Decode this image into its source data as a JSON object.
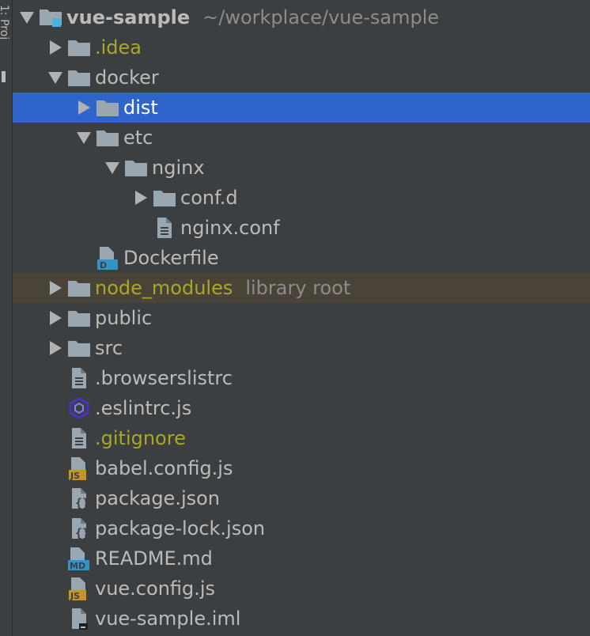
{
  "side_panel": {
    "label": "1: Proj"
  },
  "tree": [
    {
      "name": "vue-sample",
      "extra": "~/workplace/vue-sample",
      "level": 0,
      "expander": "expanded",
      "icon": "module-folder-icon",
      "style": "root"
    },
    {
      "name": ".idea",
      "level": 1,
      "expander": "collapsed",
      "icon": "folder-icon",
      "style": "ignored"
    },
    {
      "name": "docker",
      "level": 1,
      "expander": "expanded",
      "icon": "folder-icon",
      "style": "normal"
    },
    {
      "name": "dist",
      "level": 2,
      "expander": "collapsed",
      "icon": "folder-icon",
      "style": "selected"
    },
    {
      "name": "etc",
      "level": 2,
      "expander": "expanded",
      "icon": "folder-icon",
      "style": "normal"
    },
    {
      "name": "nginx",
      "level": 3,
      "expander": "expanded",
      "icon": "folder-icon",
      "style": "normal"
    },
    {
      "name": "conf.d",
      "level": 4,
      "expander": "collapsed",
      "icon": "folder-icon",
      "style": "normal"
    },
    {
      "name": "nginx.conf",
      "level": 4,
      "expander": "none",
      "icon": "text-file-icon",
      "style": "normal"
    },
    {
      "name": "Dockerfile",
      "level": 2,
      "expander": "none",
      "icon": "dockerfile-icon",
      "style": "normal"
    },
    {
      "name": "node_modules",
      "extra": "library root",
      "level": 1,
      "expander": "collapsed",
      "icon": "folder-icon",
      "style": "library"
    },
    {
      "name": "public",
      "level": 1,
      "expander": "collapsed",
      "icon": "folder-icon",
      "style": "normal"
    },
    {
      "name": "src",
      "level": 1,
      "expander": "collapsed",
      "icon": "folder-icon",
      "style": "normal"
    },
    {
      "name": ".browserslistrc",
      "level": 1,
      "expander": "none",
      "icon": "text-file-icon",
      "style": "normal"
    },
    {
      "name": ".eslintrc.js",
      "level": 1,
      "expander": "none",
      "icon": "eslint-icon",
      "style": "normal"
    },
    {
      "name": ".gitignore",
      "level": 1,
      "expander": "none",
      "icon": "text-file-icon",
      "style": "ignored"
    },
    {
      "name": "babel.config.js",
      "level": 1,
      "expander": "none",
      "icon": "js-file-icon",
      "style": "normal"
    },
    {
      "name": "package.json",
      "level": 1,
      "expander": "none",
      "icon": "json-file-icon",
      "style": "normal"
    },
    {
      "name": "package-lock.json",
      "level": 1,
      "expander": "none",
      "icon": "json-file-icon",
      "style": "normal"
    },
    {
      "name": "README.md",
      "level": 1,
      "expander": "none",
      "icon": "markdown-file-icon",
      "style": "normal"
    },
    {
      "name": "vue.config.js",
      "level": 1,
      "expander": "none",
      "icon": "js-file-icon",
      "style": "normal"
    },
    {
      "name": "vue-sample.iml",
      "level": 1,
      "expander": "none",
      "icon": "iml-file-icon",
      "style": "normal"
    }
  ],
  "colors": {
    "background": "#3c3f41",
    "selection": "#2f65ca",
    "library_row": "#4a4438",
    "ignored_text": "#a8a827",
    "text": "#bbbbbb",
    "icon_gray": "#9aa7b0",
    "js_badge": "#c6922c",
    "md_badge": "#3592c4",
    "docker_badge": "#3592c4",
    "module_marker": "#40b6e0",
    "eslint": "#4b32c3"
  }
}
